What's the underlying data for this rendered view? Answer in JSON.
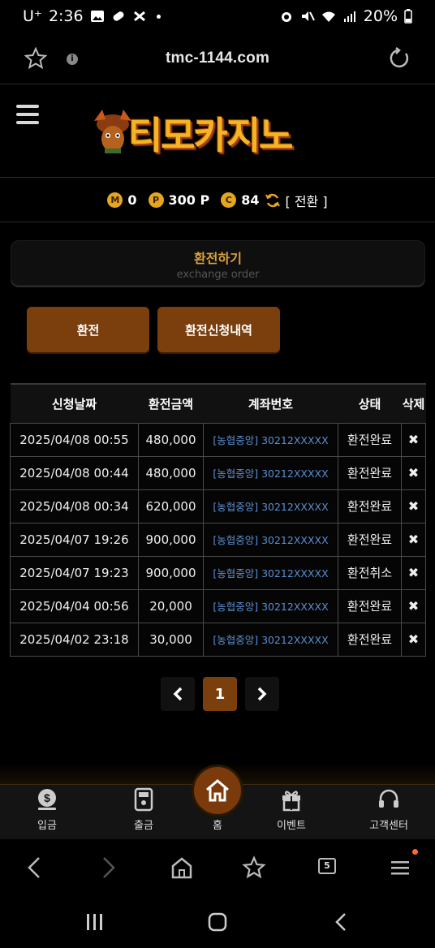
{
  "status_bar": {
    "carrier": "U⁺",
    "time": "2:36",
    "battery": "20%"
  },
  "address_bar": {
    "url": "tmc-1144.com"
  },
  "site": {
    "logo_text": "티모카지노"
  },
  "points": [
    {
      "badge": "M",
      "value": "0"
    },
    {
      "badge": "P",
      "value": "300 P"
    },
    {
      "badge": "C",
      "value": "84"
    }
  ],
  "convert_label": "[ 전환 ]",
  "section": {
    "title": "환전하기",
    "subtitle": "exchange order"
  },
  "buttons": {
    "exchange": "환전",
    "history": "환전신청내역"
  },
  "table": {
    "headers": [
      "신청날짜",
      "환전금액",
      "계좌번호",
      "상태",
      "삭제"
    ],
    "rows": [
      {
        "date": "2025/04/08 00:55",
        "amount": "480,000",
        "account": "[농협중앙] 30212XXXXX",
        "status": "환전완료",
        "delete": "✖"
      },
      {
        "date": "2025/04/08 00:44",
        "amount": "480,000",
        "account": "[농협중앙] 30212XXXXX",
        "status": "환전완료",
        "delete": "✖"
      },
      {
        "date": "2025/04/08 00:34",
        "amount": "620,000",
        "account": "[농협중앙] 30212XXXXX",
        "status": "환전완료",
        "delete": "✖"
      },
      {
        "date": "2025/04/07 19:26",
        "amount": "900,000",
        "account": "[농협중앙] 30212XXXXX",
        "status": "환전완료",
        "delete": "✖"
      },
      {
        "date": "2025/04/07 19:23",
        "amount": "900,000",
        "account": "[농협중앙] 30212XXXXX",
        "status": "환전취소",
        "delete": "✖"
      },
      {
        "date": "2025/04/04 00:56",
        "amount": "20,000",
        "account": "[농협중앙] 30212XXXXX",
        "status": "환전완료",
        "delete": "✖"
      },
      {
        "date": "2025/04/02 23:18",
        "amount": "30,000",
        "account": "[농협중앙] 30212XXXXX",
        "status": "환전완료",
        "delete": "✖"
      }
    ]
  },
  "pagination": {
    "prev": "‹",
    "current": "1",
    "next": "›"
  },
  "bottom_nav": {
    "deposit": "입금",
    "withdraw": "출금",
    "home": "홈",
    "event": "이벤트",
    "support": "고객센터"
  },
  "browser": {
    "tab_count": "5"
  },
  "colors": {
    "accent": "#7a3f0c",
    "gold": "#e4a521",
    "link": "#5a8fd1"
  }
}
